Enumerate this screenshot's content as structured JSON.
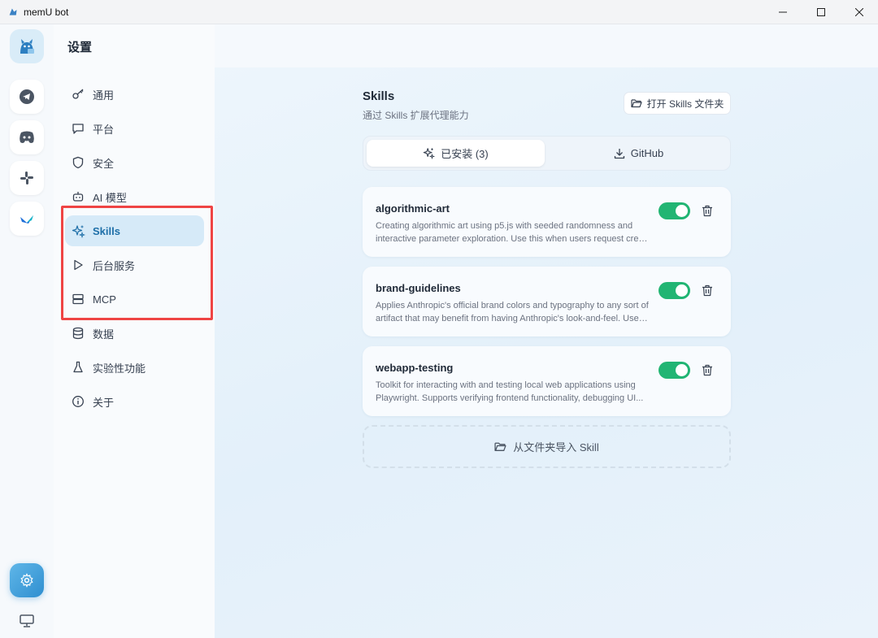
{
  "window": {
    "title": "memU bot"
  },
  "rail": {
    "items": [
      {
        "name": "telegram-icon"
      },
      {
        "name": "discord-icon"
      },
      {
        "name": "slack-icon"
      },
      {
        "name": "feishu-icon"
      }
    ],
    "settings_icon": "gear-icon",
    "monitor_icon": "monitor-icon"
  },
  "nav": {
    "title": "设置",
    "items": [
      {
        "label": "通用",
        "icon": "key-icon"
      },
      {
        "label": "平台",
        "icon": "chat-icon"
      },
      {
        "label": "安全",
        "icon": "shield-icon"
      },
      {
        "label": "AI 模型",
        "icon": "bot-icon"
      },
      {
        "label": "Skills",
        "icon": "sparkles-icon",
        "active": true
      },
      {
        "label": "后台服务",
        "icon": "play-icon"
      },
      {
        "label": "MCP",
        "icon": "server-icon"
      },
      {
        "label": "数据",
        "icon": "database-icon"
      },
      {
        "label": "实验性功能",
        "icon": "flask-icon"
      },
      {
        "label": "关于",
        "icon": "info-icon"
      }
    ]
  },
  "main": {
    "title": "Skills",
    "subtitle": "通过 Skills 扩展代理能力",
    "open_folder_label": "打开 Skills 文件夹",
    "tabs": [
      {
        "label": "已安装 (3)",
        "icon": "sparkles-icon",
        "active": true
      },
      {
        "label": "GitHub",
        "icon": "download-icon"
      }
    ],
    "skills": [
      {
        "name": "algorithmic-art",
        "desc_line1": "Creating algorithmic art using p5.js with seeded randomness and",
        "desc_line2": "interactive parameter exploration. Use this when users request creatin...",
        "enabled": true
      },
      {
        "name": "brand-guidelines",
        "desc_line1": "Applies Anthropic's official brand colors and typography to any sort of",
        "desc_line2": "artifact that may benefit from having Anthropic's look-and-feel. Use it...",
        "enabled": true
      },
      {
        "name": "webapp-testing",
        "desc_line1": "Toolkit for interacting with and testing local web applications using",
        "desc_line2": "Playwright. Supports verifying frontend functionality, debugging UI...",
        "enabled": true
      }
    ],
    "import_label": "从文件夹导入 Skill"
  },
  "colors": {
    "accent": "#2f8fd0",
    "toggle_on": "#22b573",
    "highlight": "#ef4444"
  }
}
